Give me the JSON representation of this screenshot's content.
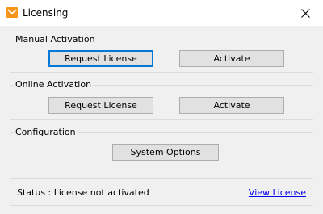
{
  "window": {
    "title": "Licensing",
    "icon": "envelope-icon",
    "close_icon": "close-icon"
  },
  "manual_activation": {
    "label": "Manual Activation",
    "request_license_label": "Request License",
    "activate_label": "Activate"
  },
  "online_activation": {
    "label": "Online Activation",
    "request_license_label": "Request License",
    "activate_label": "Activate"
  },
  "configuration": {
    "label": "Configuration",
    "system_options_label": "System Options"
  },
  "status": {
    "text": "Status : License not activated",
    "view_license_label": "View License"
  },
  "colors": {
    "accent": "#0078d7",
    "icon_orange": "#f7941d",
    "link": "#0000ee"
  }
}
